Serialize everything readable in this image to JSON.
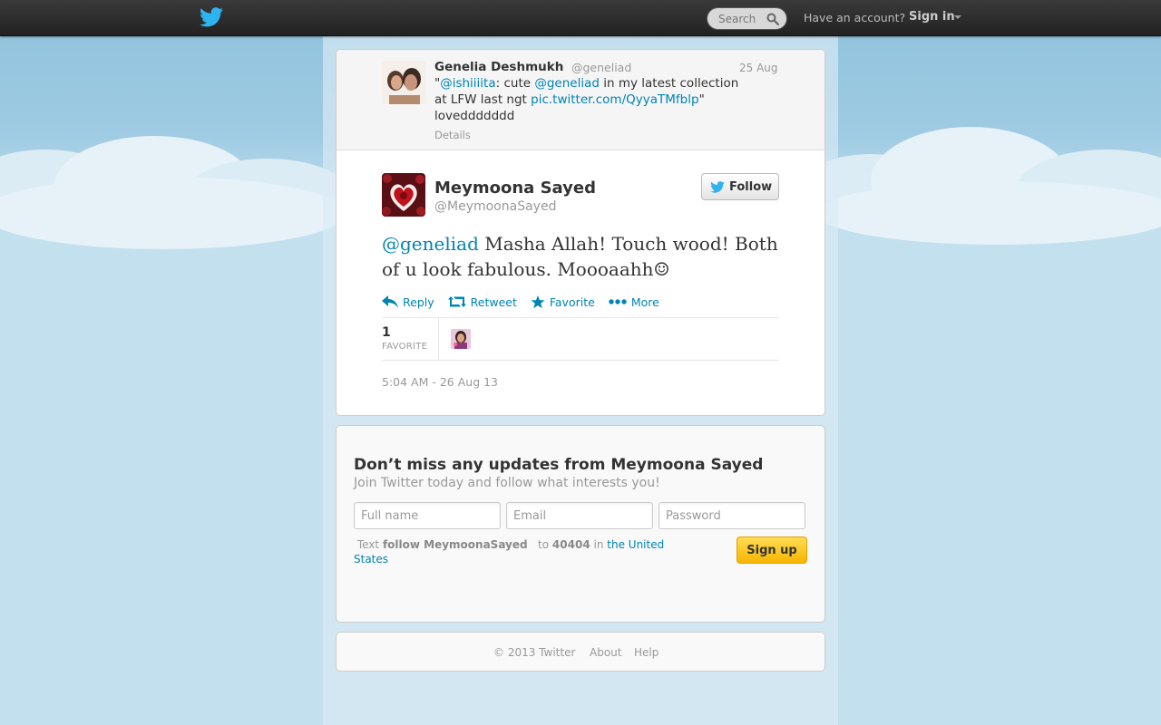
{
  "topbar": {
    "search_placeholder": "Search",
    "have_account": "Have an account?",
    "sign_in": "Sign in"
  },
  "parent_tweet": {
    "name": "Genelia Deshmukh",
    "handle": "@geneliad",
    "time": "25 Aug",
    "text_parts": {
      "open_quote": "\"",
      "mention1": "@ishiiiita",
      "mid1": ": cute ",
      "mention2": "@geneliad",
      "mid2": " in my latest collection at LFW last ngt ",
      "link": "pic.twitter.com/QyyaTMfblp",
      "end": "\" loveddddddd"
    },
    "details": "Details"
  },
  "main_tweet": {
    "name": "Meymoona Sayed",
    "handle": "@MeymoonaSayed",
    "follow_label": "Follow",
    "mention": "@geneliad",
    "text": " Masha Allah! Touch wood! Both of u look fabulous. Moooaahh☺",
    "actions": {
      "reply": "Reply",
      "retweet": "Retweet",
      "favorite": "Favorite",
      "more": "More"
    },
    "favorite_count": "1",
    "favorite_label": "FAVORITE",
    "timestamp": "5:04 AM - 26 Aug 13"
  },
  "signup": {
    "title": "Don’t miss any updates from Meymoona Sayed",
    "subtitle": "Join Twitter today and follow what interests you!",
    "full_name_placeholder": "Full name",
    "email_placeholder": "Email",
    "password_placeholder": "Password",
    "sms_prefix": "Text",
    "sms_command": "follow MeymoonaSayed",
    "sms_to": "to",
    "sms_number": "40404",
    "sms_in": "in",
    "sms_country": "the United States",
    "button": "Sign up"
  },
  "footer": {
    "copyright": "© 2013 Twitter",
    "about": "About",
    "help": "Help"
  },
  "colors": {
    "link": "#0084b4",
    "topbar": "#2b2b2b",
    "background": "#c0deed",
    "signup_button": "#f7b500"
  },
  "icons": {
    "logo": "twitter-bird-icon",
    "search": "search-icon",
    "reply": "reply-icon",
    "retweet": "retweet-icon",
    "favorite": "star-icon",
    "more": "more-dots-icon"
  }
}
